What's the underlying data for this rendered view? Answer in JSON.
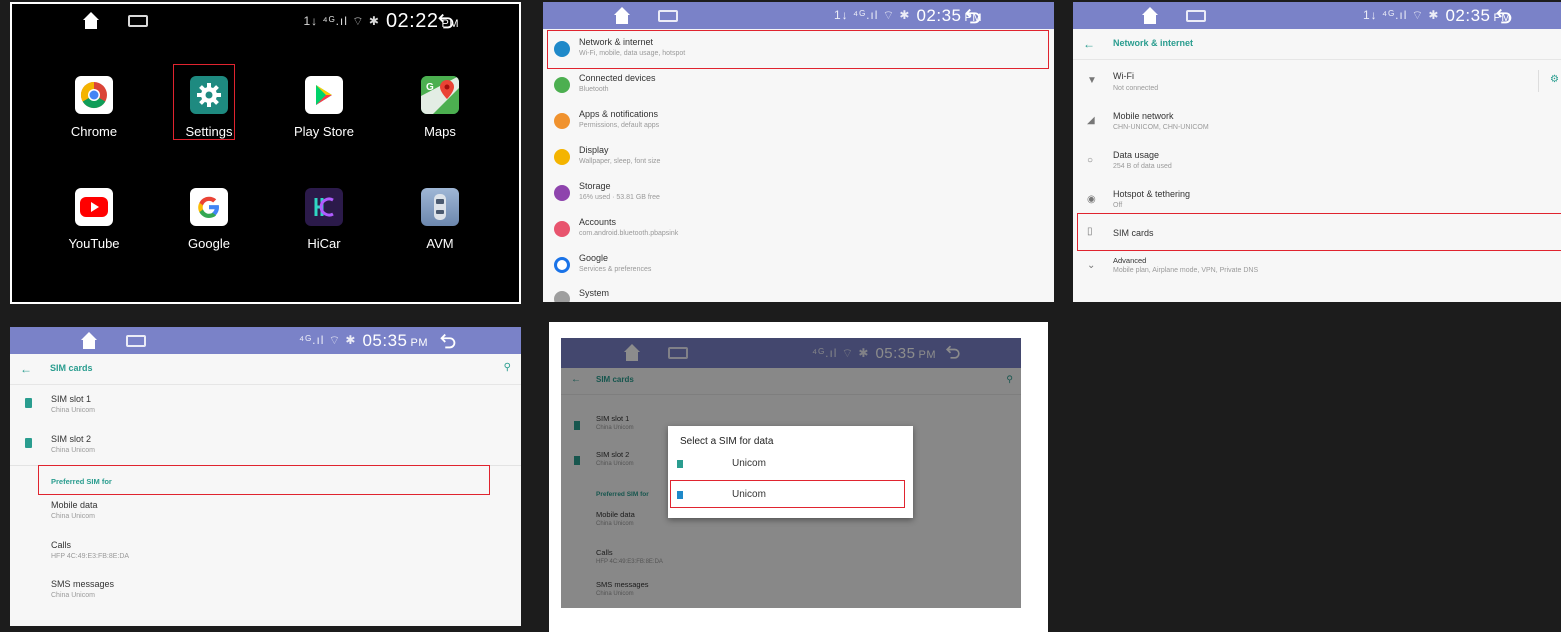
{
  "panel1": {
    "status": {
      "signal": "1↓ ⁴ᴳ.ıl ⌔ ✱",
      "time": "02:22",
      "ampm": "PM"
    },
    "apps": [
      {
        "label": "Chrome"
      },
      {
        "label": "Settings"
      },
      {
        "label": "Play Store"
      },
      {
        "label": "Maps"
      },
      {
        "label": "YouTube"
      },
      {
        "label": "Google"
      },
      {
        "label": "HiCar"
      },
      {
        "label": "AVM"
      }
    ]
  },
  "panel2": {
    "status": {
      "signal": "1↓ ⁴ᴳ.ıl ⌔ ✱",
      "time": "02:35",
      "ampm": "PM"
    },
    "items": [
      {
        "title": "Network & internet",
        "subtitle": "Wi-Fi, mobile, data usage, hotspot",
        "color": "#1f89c9"
      },
      {
        "title": "Connected devices",
        "subtitle": "Bluetooth",
        "color": "#4caf50"
      },
      {
        "title": "Apps & notifications",
        "subtitle": "Permissions, default apps",
        "color": "#f0922e"
      },
      {
        "title": "Display",
        "subtitle": "Wallpaper, sleep, font size",
        "color": "#f4b400"
      },
      {
        "title": "Storage",
        "subtitle": "16% used · 53.81 GB free",
        "color": "#8e44ad"
      },
      {
        "title": "Accounts",
        "subtitle": "com.android.bluetooth.pbapsink",
        "color": "#e8546e"
      },
      {
        "title": "Google",
        "subtitle": "Services & preferences",
        "color": "#1a73e8"
      },
      {
        "title": "System",
        "subtitle": "",
        "color": "#9e9e9e"
      }
    ]
  },
  "panel3": {
    "status": {
      "signal": "1↓ ⁴ᴳ.ıl ⌔ ✱",
      "time": "02:35",
      "ampm": "PM"
    },
    "title": "Network & internet",
    "items": [
      {
        "title": "Wi-Fi",
        "subtitle": "Not connected",
        "icon": "wifi-icon"
      },
      {
        "title": "Mobile network",
        "subtitle": "CHN-UNICOM, CHN-UNICOM",
        "icon": "cell-signal-icon"
      },
      {
        "title": "Data usage",
        "subtitle": "254 B of data used",
        "icon": "data-usage-icon"
      },
      {
        "title": "Hotspot & tethering",
        "subtitle": "Off",
        "icon": "hotspot-icon"
      },
      {
        "title": "SIM cards",
        "subtitle": "",
        "icon": "sim-card-icon"
      },
      {
        "title": "Advanced",
        "subtitle": "Mobile plan, Airplane mode, VPN, Private DNS",
        "icon": "chevron-down-icon"
      }
    ]
  },
  "panel4": {
    "status": {
      "signal": "⁴ᴳ.ıl ⌔ ✱",
      "time": "05:35",
      "ampm": "PM"
    },
    "title": "SIM cards",
    "slots": [
      {
        "title": "SIM slot 1",
        "subtitle": "China Unicom"
      },
      {
        "title": "SIM slot 2",
        "subtitle": "China Unicom"
      }
    ],
    "section": "Preferred SIM for",
    "prefs": [
      {
        "title": "Mobile data",
        "subtitle": "China Unicom"
      },
      {
        "title": "Calls",
        "subtitle": "HFP 4C:49:E3:FB:8E:DA"
      },
      {
        "title": "SMS messages",
        "subtitle": "China Unicom"
      }
    ]
  },
  "panel5": {
    "status": {
      "signal": "⁴ᴳ.ıl ⌔ ✱",
      "time": "05:35",
      "ampm": "PM"
    },
    "title": "SIM cards",
    "slots": [
      {
        "title": "SIM slot 1",
        "subtitle": "China Unicom"
      },
      {
        "title": "SIM slot 2",
        "subtitle": "China Unicom"
      }
    ],
    "section": "Preferred SIM for",
    "prefs": [
      {
        "title": "Mobile data",
        "subtitle": "China Unicom"
      },
      {
        "title": "Calls",
        "subtitle": "HFP 4C:49:E3:FB:8E:DA"
      },
      {
        "title": "SMS messages",
        "subtitle": "China Unicom"
      }
    ],
    "dialog": {
      "title": "Select a SIM for data",
      "options": [
        {
          "label": "Unicom"
        },
        {
          "label": "Unicom"
        }
      ]
    }
  },
  "colors": {
    "accent": "#2a9d8f",
    "highlight": "#e0242f",
    "statusbar": "#7a82c8"
  }
}
